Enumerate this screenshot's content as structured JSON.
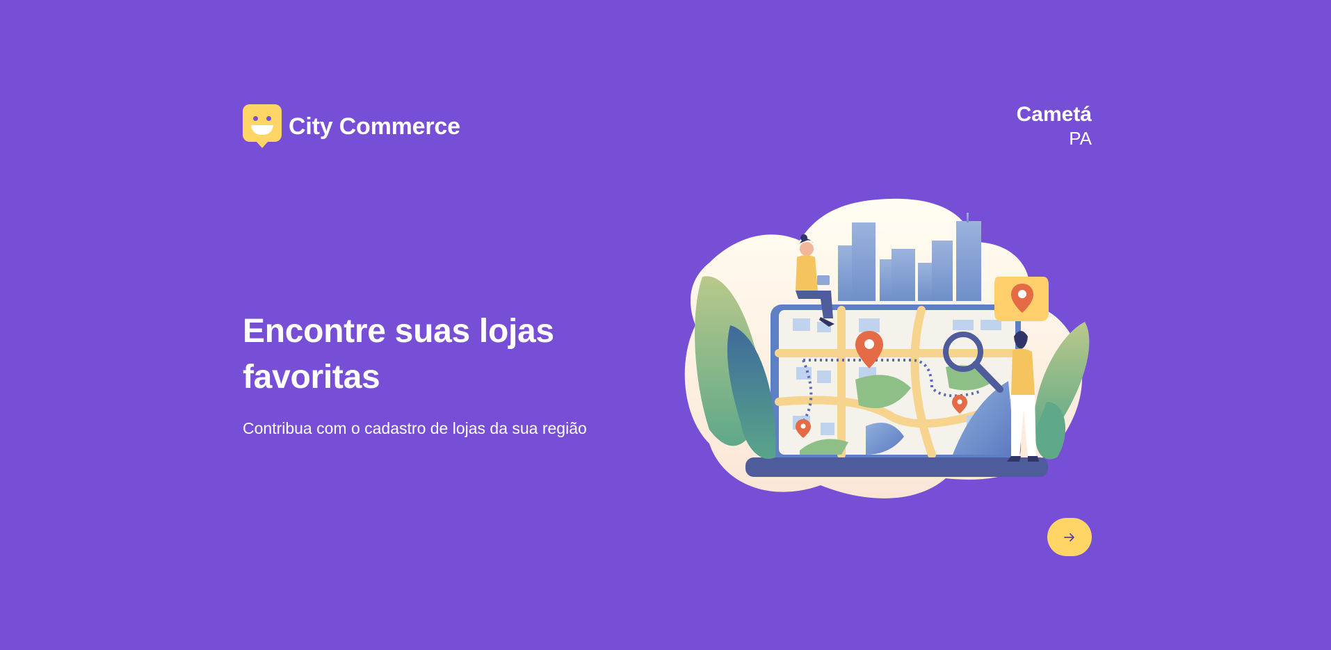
{
  "header": {
    "brand_name": "City Commerce",
    "logo_icon": "smiley-chat-bubble-icon",
    "location_city": "Cametá",
    "location_state": "PA"
  },
  "hero": {
    "title": "Encontre suas lojas favoritas",
    "subtitle": "Contribua com o cadastro de lojas da sua região",
    "illustration": "city-map-illustration"
  },
  "actions": {
    "next_icon": "arrow-right-icon"
  },
  "colors": {
    "background": "#774FD6",
    "accent": "#FFD666",
    "text": "#FFFFFF",
    "icon_dark": "#5A3FA8"
  }
}
